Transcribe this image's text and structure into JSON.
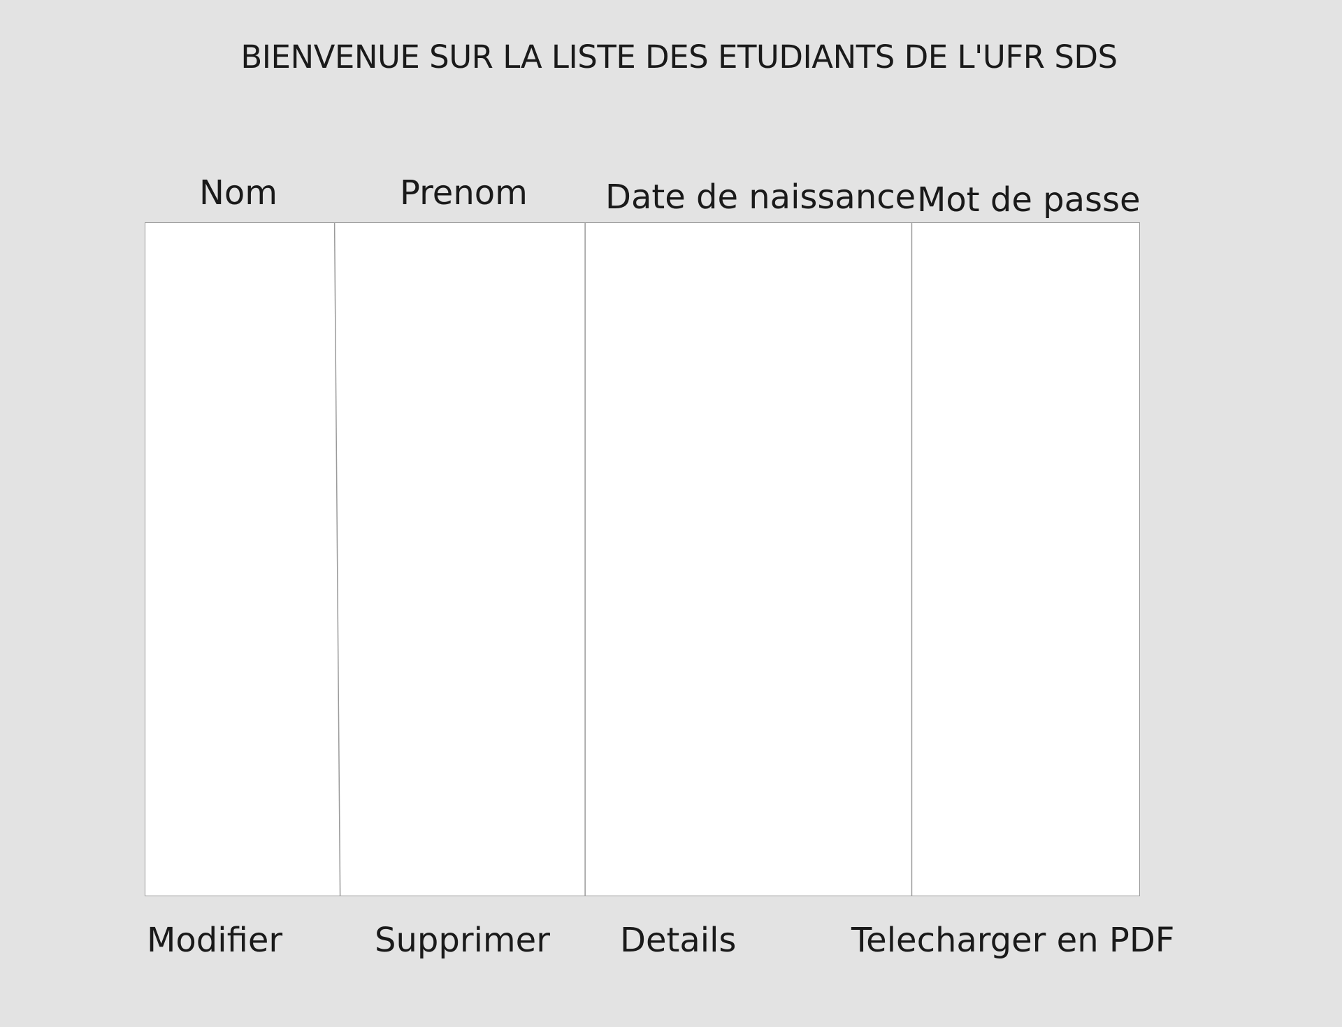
{
  "page": {
    "title": "BIENVENUE SUR LA LISTE DES ETUDIANTS DE L'UFR SDS"
  },
  "table": {
    "columns": [
      "Nom",
      "Prenom",
      "Date de naissance",
      "Mot de passe"
    ],
    "rows": []
  },
  "actions": {
    "modifier": "Modifier",
    "supprimer": "Supprimer",
    "details": "Details",
    "telecharger": "Telecharger en PDF"
  },
  "colors": {
    "background": "#e3e3e3",
    "table_background": "#ffffff",
    "border": "#9a9a9a"
  }
}
